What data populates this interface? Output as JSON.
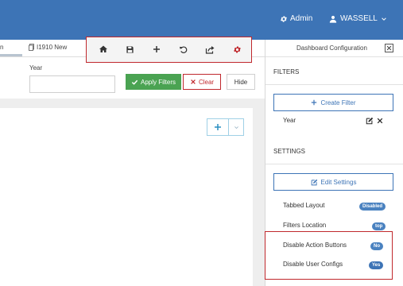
{
  "header": {
    "admin_label": "Admin",
    "user_label": "WASSELL",
    "bg_color": "#3d74b6"
  },
  "tabs": {
    "partial_label": "n",
    "item_icon": "document-icon",
    "item_label": "I1910 New"
  },
  "toolbar": {
    "buttons": [
      {
        "icon": "home-icon"
      },
      {
        "icon": "save-icon"
      },
      {
        "icon": "plus-icon"
      },
      {
        "icon": "undo-icon"
      },
      {
        "icon": "share-icon"
      },
      {
        "icon": "gear-icon",
        "color": "#c0282d"
      }
    ]
  },
  "filters_bar": {
    "year_label": "Year",
    "year_value": "",
    "apply_label": "Apply Filters",
    "clear_label": "Clear",
    "hide_label": "Hide",
    "apply_color": "#4aa352",
    "clear_color": "#c0282d"
  },
  "sidebar": {
    "title": "Dashboard Configuration",
    "filters_heading": "FILTERS",
    "create_filter_label": "Create Filter",
    "filter_items": [
      {
        "label": "Year"
      }
    ],
    "settings_heading": "SETTINGS",
    "edit_settings_label": "Edit Settings",
    "settings": [
      {
        "label": "Tabbed Layout",
        "value": "Disabled"
      },
      {
        "label": "Filters Location",
        "value": "top"
      },
      {
        "label": "Disable Action Buttons",
        "value": "No"
      },
      {
        "label": "Disable User Configs",
        "value": "Yes"
      }
    ]
  }
}
